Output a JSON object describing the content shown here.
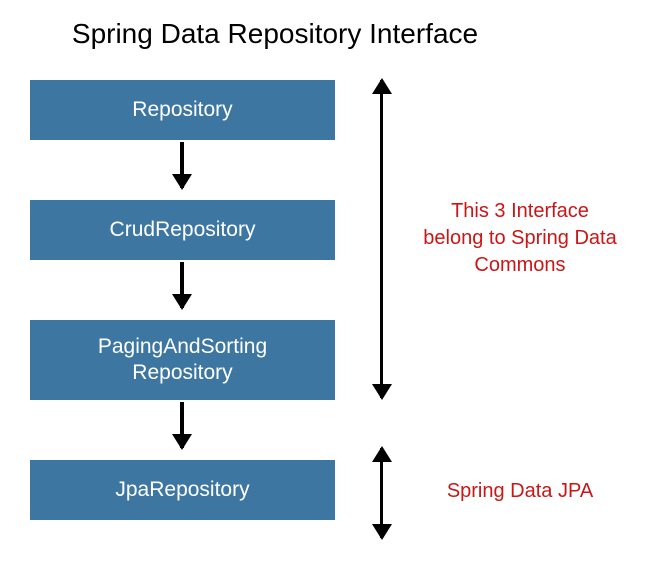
{
  "title": "Spring Data Repository Interface",
  "boxes": [
    {
      "label": "Repository"
    },
    {
      "label": "CrudRepository"
    },
    {
      "label": "PagingAndSorting\nRepository"
    },
    {
      "label": "JpaRepository"
    }
  ],
  "annotations": [
    {
      "text": "This 3 Interface belong to Spring Data Commons"
    },
    {
      "text": "Spring Data JPA"
    }
  ]
}
